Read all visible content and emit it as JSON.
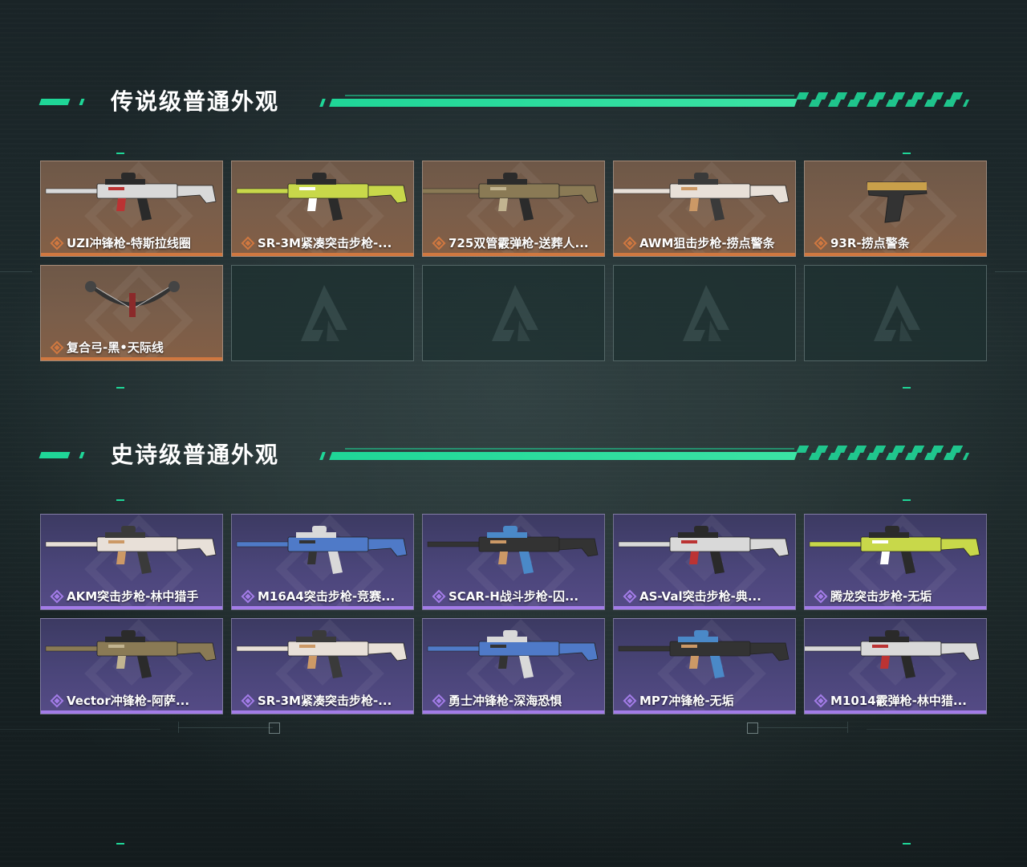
{
  "colors": {
    "accent": "#1fd697",
    "legendary_bg": "#7a5e4a",
    "legendary_underline": "#d07840",
    "epic_bg": "#4a4579",
    "epic_underline": "#a37ce8"
  },
  "sections": [
    {
      "title": "传说级普通外观",
      "rarity": "legendary",
      "items": [
        {
          "label": "UZI冲锋枪-特斯拉线圈",
          "icon": "uzi-smg-icon"
        },
        {
          "label": "SR-3M紧凑突击步枪-...",
          "icon": "assault-rifle-icon"
        },
        {
          "label": "725双管霰弹枪-送葬人...",
          "icon": "shotgun-icon"
        },
        {
          "label": "AWM狙击步枪-捞点警条",
          "icon": "sniper-rifle-icon"
        },
        {
          "label": "93R-捞点警条",
          "icon": "pistol-icon"
        },
        {
          "label": "复合弓-黑•天际线",
          "icon": "compound-bow-icon"
        }
      ],
      "empty_slots": 4
    },
    {
      "title": "史诗级普通外观",
      "rarity": "epic",
      "items": [
        {
          "label": "AKM突击步枪-林中猎手",
          "icon": "assault-rifle-icon"
        },
        {
          "label": "M16A4突击步枪-竞赛...",
          "icon": "assault-rifle-icon"
        },
        {
          "label": "SCAR-H战斗步枪-囚...",
          "icon": "battle-rifle-icon"
        },
        {
          "label": "AS-Val突击步枪-典...",
          "icon": "assault-rifle-icon"
        },
        {
          "label": "腾龙突击步枪-无垢",
          "icon": "assault-rifle-icon"
        },
        {
          "label": "Vector冲锋枪-阿萨...",
          "icon": "smg-icon"
        },
        {
          "label": "SR-3M紧凑突击步枪-...",
          "icon": "assault-rifle-icon"
        },
        {
          "label": "勇士冲锋枪-深海恐惧",
          "icon": "smg-icon"
        },
        {
          "label": "MP7冲锋枪-无垢",
          "icon": "smg-icon"
        },
        {
          "label": "M1014霰弹枪-林中猎...",
          "icon": "shotgun-icon"
        }
      ],
      "empty_slots": 0
    }
  ]
}
